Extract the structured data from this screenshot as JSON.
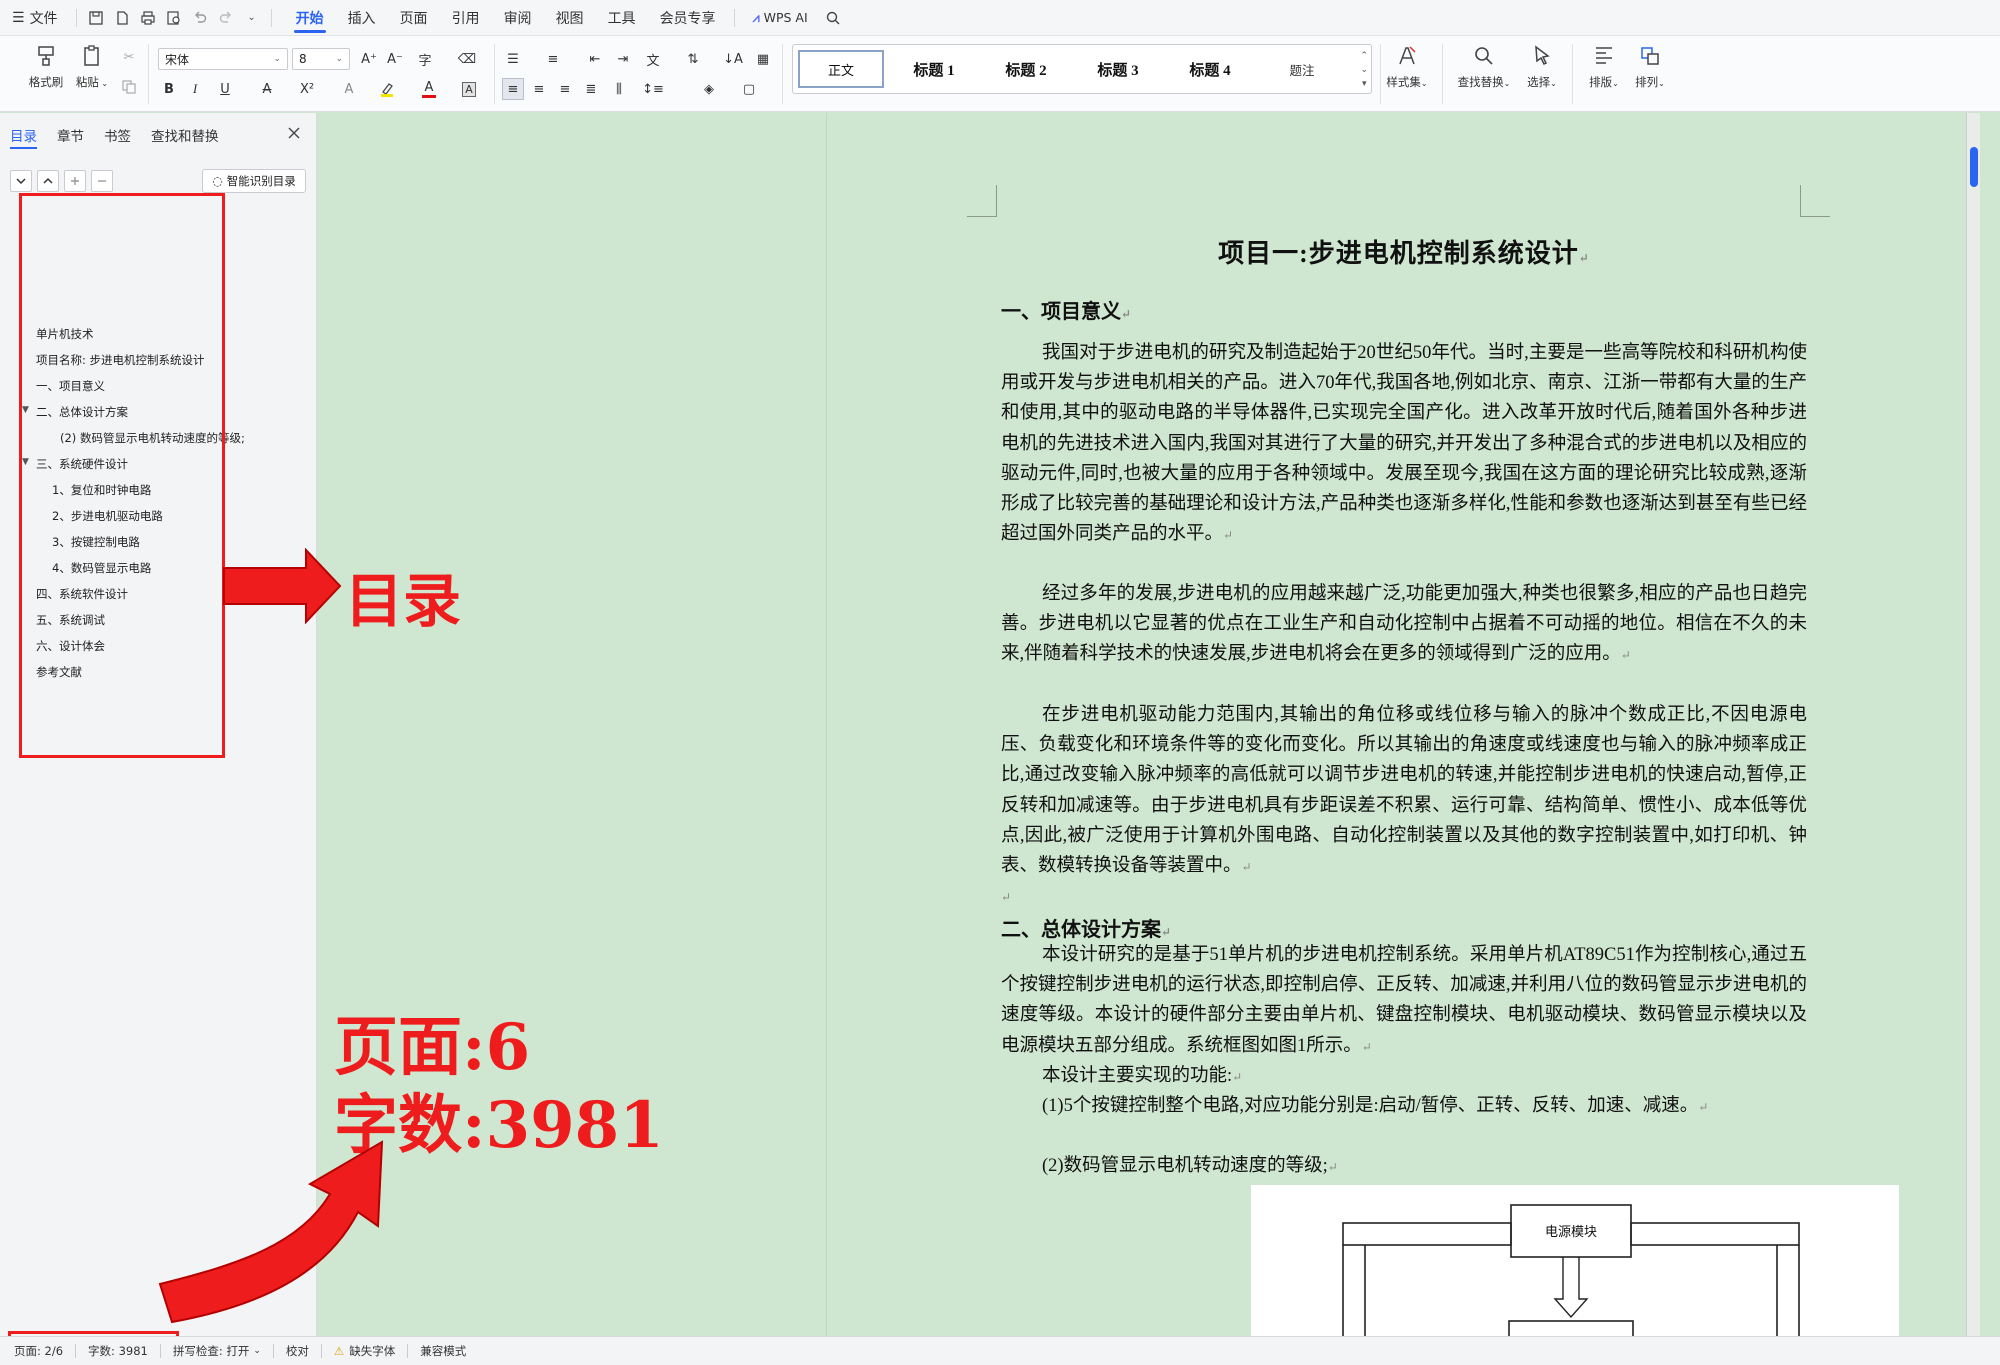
{
  "menubar": {
    "file": "文件",
    "tabs": [
      "开始",
      "插入",
      "页面",
      "引用",
      "审阅",
      "视图",
      "工具",
      "会员专享"
    ],
    "active_tab": "开始",
    "wps_ai": "WPS AI"
  },
  "ribbon": {
    "format_painter": "格式刷",
    "paste": "粘贴",
    "font_name": "宋体",
    "font_size": "8",
    "styles": [
      "正文",
      "标题 1",
      "标题 2",
      "标题 3",
      "标题 4",
      "题注"
    ],
    "style_set": "样式集",
    "find_replace": "查找替换",
    "select": "选择",
    "layout": "排版",
    "arrange": "排列",
    "bold": "B",
    "italic": "I",
    "underline": "U",
    "strike": "A",
    "superscript": "X²",
    "font_color_a": "A"
  },
  "nav": {
    "tabs": [
      "目录",
      "章节",
      "书签",
      "查找和替换"
    ],
    "active_tab": "目录",
    "smart_toc": "智能识别目录",
    "toc": [
      {
        "text": "单片机技术",
        "level": 0
      },
      {
        "text": "项目名称:    步进电机控制系统设计",
        "level": 0
      },
      {
        "text": "一、项目意义",
        "level": 0
      },
      {
        "text": "二、总体设计方案",
        "level": 0,
        "expanded": true
      },
      {
        "text": "(2) 数码管显示电机转动速度的等级;",
        "level": 1
      },
      {
        "text": "三、系统硬件设计",
        "level": 0,
        "expanded": true
      },
      {
        "text": "1、复位和时钟电路",
        "level": 1
      },
      {
        "text": "2、步进电机驱动电路",
        "level": 1
      },
      {
        "text": "3、按键控制电路",
        "level": 1
      },
      {
        "text": "4、数码管显示电路",
        "level": 1
      },
      {
        "text": "四、系统软件设计",
        "level": 0
      },
      {
        "text": "五、系统调试",
        "level": 0
      },
      {
        "text": "六、设计体会",
        "level": 0
      },
      {
        "text": "参考文献",
        "level": 0
      }
    ]
  },
  "annotations": {
    "toc_label": "目录",
    "page_label": "页面:6",
    "words_label": "字数:3981"
  },
  "document": {
    "title": "项目一:步进电机控制系统设计",
    "h1": "一、项目意义",
    "p1": "我国对于步进电机的研究及制造起始于20世纪50年代。当时,主要是一些高等院校和科研机构使用或开发与步进电机相关的产品。进入70年代,我国各地,例如北京、南京、江浙一带都有大量的生产和使用,其中的驱动电路的半导体器件,已实现完全国产化。进入改革开放时代后,随着国外各种步进电机的先进技术进入国内,我国对其进行了大量的研究,并开发出了多种混合式的步进电机以及相应的驱动元件,同时,也被大量的应用于各种领域中。发展至现今,我国在这方面的理论研究比较成熟,逐渐形成了比较完善的基础理论和设计方法,产品种类也逐渐多样化,性能和参数也逐渐达到甚至有些已经超过国外同类产品的水平。",
    "p2": "经过多年的发展,步进电机的应用越来越广泛,功能更加强大,种类也很繁多,相应的产品也日趋完善。步进电机以它显著的优点在工业生产和自动化控制中占据着不可动摇的地位。相信在不久的未来,伴随着科学技术的快速发展,步进电机将会在更多的领域得到广泛的应用。",
    "p3": "在步进电机驱动能力范围内,其输出的角位移或线位移与输入的脉冲个数成正比,不因电源电压、负载变化和环境条件等的变化而变化。所以其输出的角速度或线速度也与输入的脉冲频率成正比,通过改变输入脉冲频率的高低就可以调节步进电机的转速,并能控制步进电机的快速启动,暂停,正反转和加减速等。由于步进电机具有步距误差不积累、运行可靠、结构简单、惯性小、成本低等优点,因此,被广泛使用于计算机外围电路、自动化控制装置以及其他的数字控制装置中,如打印机、钟表、数模转换设备等装置中。",
    "h2": "二、总体设计方案",
    "p4": "本设计研究的是基于51单片机的步进电机控制系统。采用单片机AT89C51作为控制核心,通过五个按键控制步进电机的运行状态,即控制启停、正反转、加减速,并利用八位的数码管显示步进电机的速度等级。本设计的硬件部分主要由单片机、键盘控制模块、电机驱动模块、数码管显示模块以及电源模块五部分组成。系统框图如图1所示。",
    "p5": "本设计主要实现的功能:",
    "p6": "(1)5个按键控制整个电路,对应功能分别是:启动/暂停、正转、反转、加速、减速。",
    "p7": "(2)数码管显示电机转动速度的等级;",
    "figure_box": "电源模块"
  },
  "statusbar": {
    "page": "页面: 2/6",
    "words": "字数: 3981",
    "spell": "拼写检查: 打开",
    "proof": "校对",
    "missing_font": "缺失字体",
    "compat": "兼容模式"
  },
  "colors": {
    "accent": "#2b64f0",
    "annotation_red": "#ee1c1c",
    "doc_bg": "#cfe6d0"
  }
}
